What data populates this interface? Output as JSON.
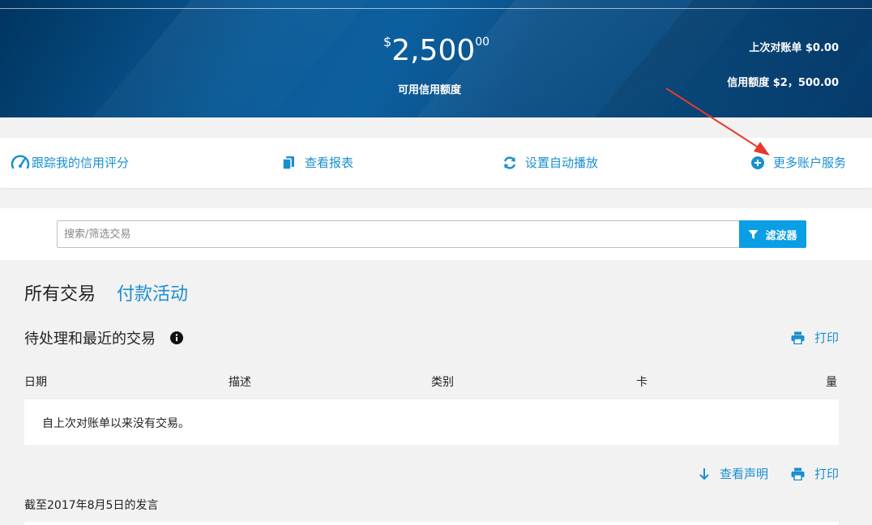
{
  "hero": {
    "currency_symbol": "$",
    "amount_main": "2,500",
    "amount_cents": "00",
    "available_label": "可用信用额度",
    "last_statement": "上次对账单 $0.00",
    "credit_limit": "信用额度 $2，500.00"
  },
  "actions": {
    "track_score": "跟踪我的信用评分",
    "view_statements": "查看报表",
    "autopay": "设置自动播放",
    "more_services": "更多账户服务"
  },
  "search": {
    "placeholder": "搜索/筛选交易",
    "filter_label": "滤波器"
  },
  "tabs": {
    "all": "所有交易",
    "payments": "付款活动"
  },
  "transactions": {
    "section_title": "待处理和最近的交易",
    "print_label": "打印",
    "columns": [
      "日期",
      "描述",
      "类别",
      "卡",
      "量"
    ],
    "empty_message": "自上次对账单以来没有交易。",
    "view_statement": "查看声明",
    "print_label_2": "打印",
    "as_of": "截至2017年8月5日的发言"
  },
  "colors": {
    "accent": "#1a8fd0",
    "filter_button": "#0a9ee4",
    "hero_bg": "#0a5a97",
    "annotation": "#e8392f"
  }
}
